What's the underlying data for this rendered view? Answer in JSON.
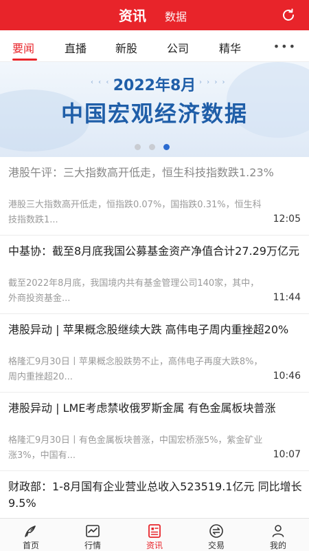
{
  "header": {
    "active_tab": "资讯",
    "other_tab": "数据",
    "icon": "refresh-icon"
  },
  "categories": [
    "要闻",
    "直播",
    "新股",
    "公司",
    "精华"
  ],
  "more_icon": "more-dots-icon",
  "banner": {
    "year_text": "2022年8月",
    "title": "中国宏观经济数据",
    "slide_count": 3,
    "active_slide": 3
  },
  "articles": [
    {
      "title": "港股午评：三大指数高开低走，恒生科技指数跌1.23%",
      "summary": "港股三大指数高开低走，恒指跌0.07%，国指跌0.31%，恒生科技指数跌1...",
      "time": "12:05",
      "read": true
    },
    {
      "title": "中基协：截至8月底我国公募基金资产净值合计27.29万亿元",
      "summary": "截至2022年8月底，我国境内共有基金管理公司140家，其中，外商投资基金...",
      "time": "11:44",
      "read": false
    },
    {
      "title": "港股异动 | 苹果概念股继续大跌 高伟电子周内重挫超20%",
      "summary": "格隆汇9月30日丨苹果概念股跌势不止，高伟电子再度大跌8%，周内重挫超20...",
      "time": "10:46",
      "read": false
    },
    {
      "title": "港股异动 | LME考虑禁收俄罗斯金属 有色金属板块普涨",
      "summary": "格隆汇9月30日丨有色金属板块普涨，中国宏桥涨5%，紫金矿业涨3%，中国有...",
      "time": "10:07",
      "read": false
    },
    {
      "title": "财政部：1-8月国有企业营业总收入523519.1亿元 同比增长9.5%",
      "summary": "",
      "time": "",
      "read": false
    }
  ],
  "bottom_nav": [
    {
      "label": "首页",
      "icon": "home-icon"
    },
    {
      "label": "行情",
      "icon": "market-chart-icon"
    },
    {
      "label": "资讯",
      "icon": "news-icon"
    },
    {
      "label": "交易",
      "icon": "trade-exchange-icon"
    },
    {
      "label": "我的",
      "icon": "profile-icon"
    }
  ],
  "colors": {
    "brand_red": "#e8242a",
    "banner_blue": "#1f5ea8",
    "active_dot": "#2b6bd0"
  }
}
